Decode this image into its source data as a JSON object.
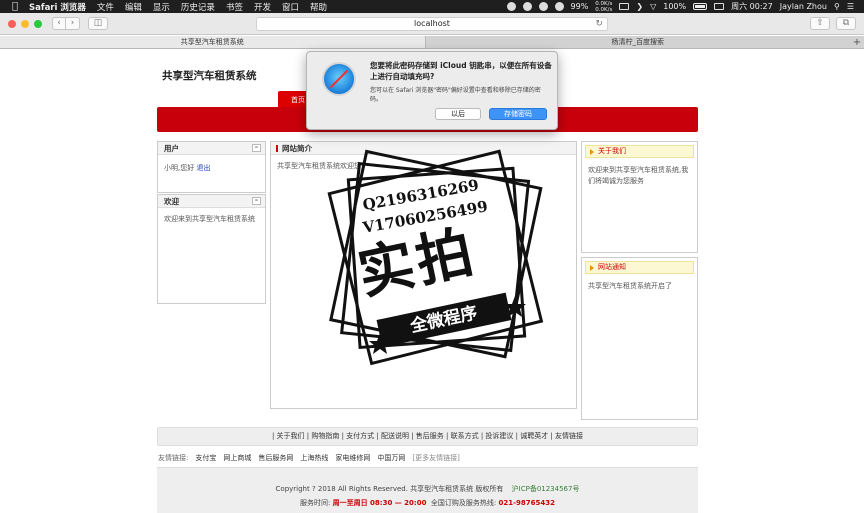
{
  "menubar": {
    "app_name": "Safari 浏览器",
    "menus": [
      "文件",
      "编辑",
      "显示",
      "历史记录",
      "书签",
      "开发",
      "窗口",
      "帮助"
    ],
    "battery": "99%",
    "net_up": "0.0K/s",
    "net_down": "0.0K/s",
    "battery2": "100%",
    "clock": "周六 00:27",
    "user": "Jaylan Zhou"
  },
  "toolbar": {
    "url": "localhost"
  },
  "tabs": [
    {
      "label": "共享型汽车租赁系统",
      "active": true
    },
    {
      "label": "杨清柠_百度搜索",
      "active": false
    }
  ],
  "site": {
    "title": "共享型汽车租赁系统",
    "nav_first": "首页"
  },
  "user_box": {
    "title": "用户",
    "greeting": "小明,您好",
    "logout": "退出"
  },
  "welcome_box": {
    "title": "欢迎",
    "text": "欢迎来到共享型汽车租赁系统"
  },
  "intro_box": {
    "title": "网站简介",
    "text": "共享型汽车租赁系统欢迎您"
  },
  "about_box": {
    "title": "关于我们",
    "text": "欢迎来到共享型汽车租赁系统,我们将竭诚为您服务"
  },
  "notice_box": {
    "title": "网站通知",
    "text": "共享型汽车租赁系统开启了"
  },
  "linkbar": {
    "items": [
      "关于我们",
      "购物指南",
      "支付方式",
      "配送说明",
      "售后服务",
      "联系方式",
      "投诉建议",
      "诚聘英才",
      "友情链接"
    ]
  },
  "friend_links": {
    "label": "友情链接:",
    "items": [
      "支付宝",
      "网上商城",
      "售后服务网",
      "上海热线",
      "家电维修网",
      "中国万网"
    ],
    "more": "[更多友情链接]"
  },
  "footer": {
    "copyright": "Copyright ? 2018 All Rights Reserved. 共享型汽车租赁系统 版权所有",
    "icp": "沪ICP备01234567号",
    "hours_label": "服务时间:",
    "hours": "周一至周日 08:30 — 20:00",
    "hotline_label": "全国订购及服务热线:",
    "hotline": "021-98765432"
  },
  "dialog": {
    "title": "您要将此密码存储到 iCloud 钥匙串，以便在所有设备上进行自动填充吗?",
    "body": "您可以在 Safari 浏览器\"密码\"偏好设置中查看和移除已存储的密码。",
    "later": "以后",
    "save": "存储密码"
  },
  "watermark": {
    "line1": "Q2196316269",
    "line2": "V17060256499",
    "big": "实拍",
    "ribbon": "全微程序"
  },
  "colors": {
    "nav_red": "#c8000b",
    "dialog_blue": "#3d94f6"
  }
}
